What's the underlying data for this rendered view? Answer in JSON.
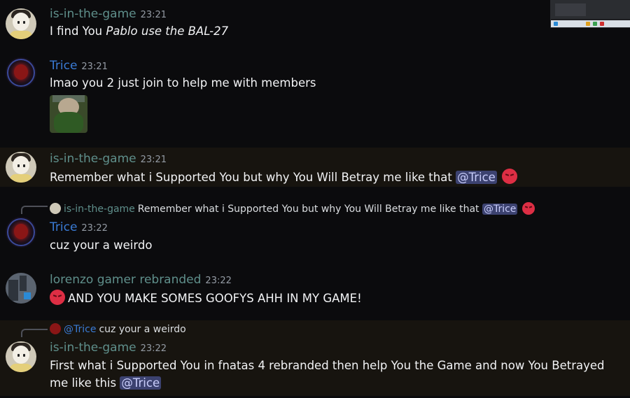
{
  "messages": [
    {
      "author": "is-in-the-game",
      "time": "23:21",
      "text_before": "I find You ",
      "text_italic": "Pablo use the BAL-27"
    },
    {
      "author": "Trice",
      "time": "23:21",
      "text": "lmao you 2 just join to help me with members",
      "attachment": "image-attachment"
    },
    {
      "author": "is-in-the-game",
      "time": "23:21",
      "text": "Remember what i Supported You but why You Will Betray me like that ",
      "mention": "@Trice",
      "emoji": "angry-face-icon"
    },
    {
      "reply_to": {
        "author": "is-in-the-game",
        "text": "Remember what i Supported You but why You Will Betray me like that ",
        "mention": "@Trice"
      },
      "author": "Trice",
      "time": "23:22",
      "text": "cuz your a weirdo"
    },
    {
      "author": "lorenzo gamer rebranded",
      "time": "23:22",
      "text": "AND YOU MAKE SOMES GOOFYS AHH IN MY GAME!"
    },
    {
      "reply_to": {
        "mention": "@Trice",
        "text": "cuz your a weirdo"
      },
      "author": "is-in-the-game",
      "time": "23:22",
      "text": "First what i Supported You in fnatas 4 rebranded then help You the Game and now You Betrayed me like this ",
      "mention": "@Trice"
    }
  ],
  "colors": {
    "background": "#0b0b0d",
    "highlight": "#17140f",
    "mention_bg": "#3c4270",
    "name_trice": "#3a7bd5",
    "name_game": "#5f8f8b"
  }
}
